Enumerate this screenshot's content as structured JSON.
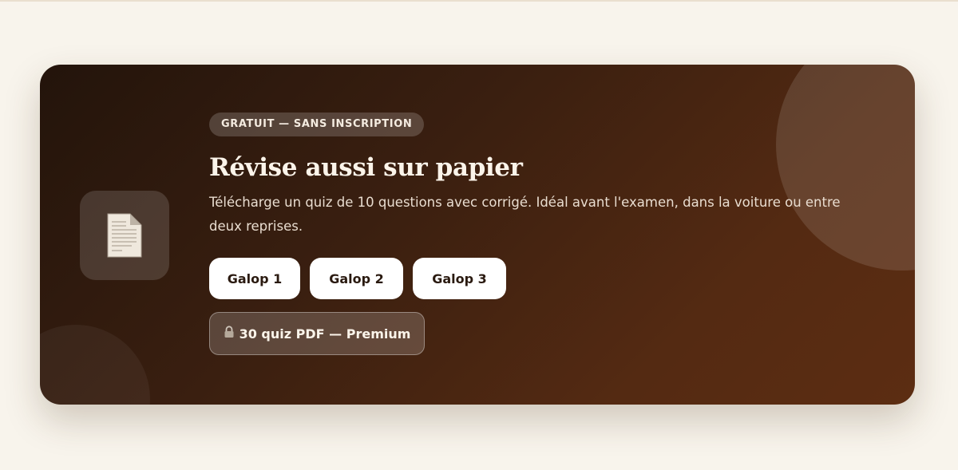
{
  "promo": {
    "badge": "GRATUIT — SANS INSCRIPTION",
    "title": "Révise aussi sur papier",
    "description": "Télécharge un quiz de 10 questions avec corrigé. Idéal avant l'examen, dans la voiture ou entre deux reprises.",
    "buttons": [
      {
        "label": "Galop 1"
      },
      {
        "label": "Galop 2"
      },
      {
        "label": "Galop 3"
      }
    ],
    "premium_label": "30 quiz PDF — Premium",
    "icons": {
      "document": "document-icon",
      "lock": "lock-icon"
    },
    "colors": {
      "page_background": "#f8f4ec",
      "card_gradient_start": "#23140b",
      "card_gradient_end": "#5c2d12",
      "button_background": "#ffffff",
      "button_text": "#2a1a10"
    }
  }
}
